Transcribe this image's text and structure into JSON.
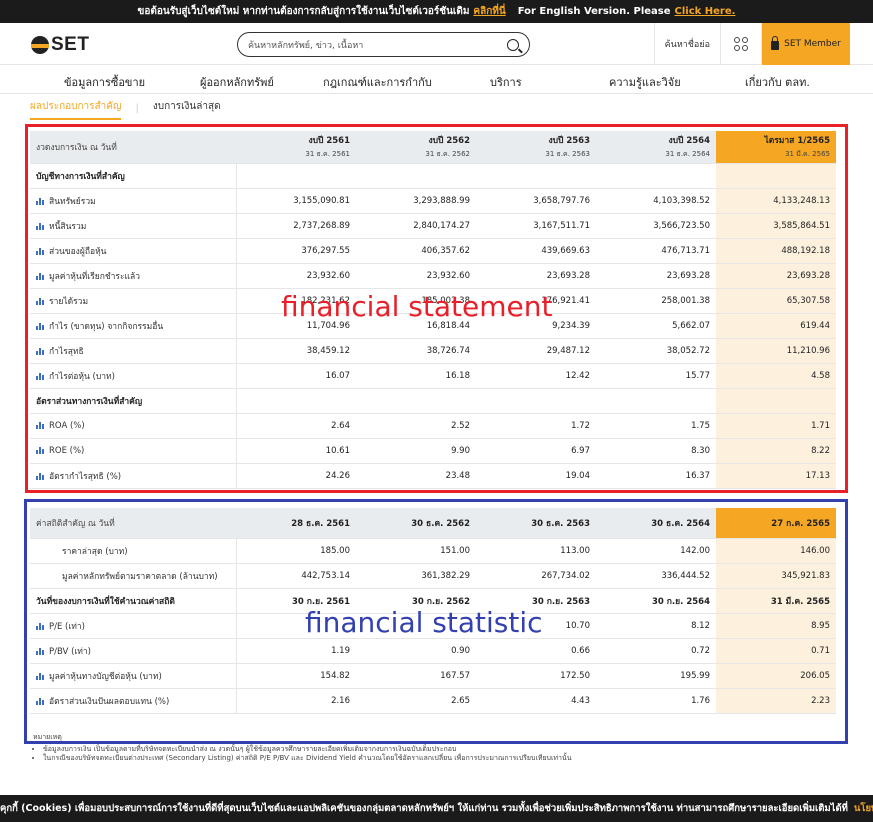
{
  "topbar": {
    "message": "ขอต้อนรับสู่เว็บไซต์ใหม่ หากท่านต้องการกลับสู่การใช้งานเว็บไซต์เวอร์ชันเดิม",
    "click_here_th": "คลิกที่นี่",
    "english_prompt": "For English Version. Please",
    "click_here_en": "Click Here."
  },
  "header": {
    "logo_text": "SET",
    "search_placeholder": "ค้นหาหลักทรัพย์, ข่าว, เนื้อหา",
    "quick_search": "ค้นหาชื่อย่อ",
    "member_label": "SET Member"
  },
  "nav": [
    "ข้อมูลการซื้อขาย",
    "ผู้ออกหลักทรัพย์",
    "กฎเกณฑ์และการกำกับ",
    "บริการ",
    "ความรู้และวิจัย",
    "เกี่ยวกับ ตลท."
  ],
  "subnav": {
    "active": "ผลประกอบการสำคัญ",
    "other": "งบการเงินล่าสุด"
  },
  "statement": {
    "header_label": "งวดงบการเงิน ณ วันที่",
    "columns": [
      {
        "title": "งบปี 2561",
        "date": "31 ธ.ค. 2561"
      },
      {
        "title": "งบปี 2562",
        "date": "31 ธ.ค. 2562"
      },
      {
        "title": "งบปี 2563",
        "date": "31 ธ.ค. 2563"
      },
      {
        "title": "งบปี 2564",
        "date": "31 ธ.ค. 2564"
      },
      {
        "title": "ไตรมาส 1/2565",
        "date": "31 มี.ค. 2565"
      }
    ],
    "section1": "บัญชีทางการเงินที่สำคัญ",
    "rows1": [
      {
        "label": "สินทรัพย์รวม",
        "values": [
          "3,155,090.81",
          "3,293,888.99",
          "3,658,797.76",
          "4,103,398.52",
          "4,133,248.13"
        ]
      },
      {
        "label": "หนี้สินรวม",
        "values": [
          "2,737,268.89",
          "2,840,174.27",
          "3,167,511.71",
          "3,566,723.50",
          "3,585,864.51"
        ]
      },
      {
        "label": "ส่วนของผู้ถือหุ้น",
        "values": [
          "376,297.55",
          "406,357.62",
          "439,669.63",
          "476,713.71",
          "488,192.18"
        ]
      },
      {
        "label": "มูลค่าหุ้นที่เรียกชำระแล้ว",
        "values": [
          "23,932.60",
          "23,932.60",
          "23,693.28",
          "23,693.28",
          "23,693.28"
        ]
      },
      {
        "label": "รายได้รวม",
        "values": [
          "182,231.62",
          "185,002.38",
          "176,921.41",
          "258,001.38",
          "65,307.58"
        ]
      },
      {
        "label": "กำไร (ขาดทุน) จากกิจกรรมอื่น",
        "values": [
          "11,704.96",
          "16,818.44",
          "9,234.39",
          "5,662.07",
          "619.44"
        ]
      },
      {
        "label": "กำไรสุทธิ",
        "values": [
          "38,459.12",
          "38,726.74",
          "29,487.12",
          "38,052.72",
          "11,210.96"
        ]
      },
      {
        "label": "กำไรต่อหุ้น (บาท)",
        "values": [
          "16.07",
          "16.18",
          "12.42",
          "15.77",
          "4.58"
        ]
      }
    ],
    "section2": "อัตราส่วนทางการเงินที่สำคัญ",
    "rows2": [
      {
        "label": "ROA (%)",
        "values": [
          "2.64",
          "2.52",
          "1.72",
          "1.75",
          "1.71"
        ]
      },
      {
        "label": "ROE (%)",
        "values": [
          "10.61",
          "9.90",
          "6.97",
          "8.30",
          "8.22"
        ]
      },
      {
        "label": "อัตรากำไรสุทธิ (%)",
        "values": [
          "24.26",
          "23.48",
          "19.04",
          "16.37",
          "17.13"
        ]
      }
    ]
  },
  "statistic": {
    "header_label": "ค่าสถิติสำคัญ ณ วันที่",
    "columns": [
      "28 ธ.ค. 2561",
      "30 ธ.ค. 2562",
      "30 ธ.ค. 2563",
      "30 ธ.ค. 2564",
      "27 ก.ค. 2565"
    ],
    "rows_top": [
      {
        "label": "ราคาล่าสุด (บาท)",
        "values": [
          "185.00",
          "151.00",
          "113.00",
          "142.00",
          "146.00"
        ]
      },
      {
        "label": "มูลค่าหลักทรัพย์ตามราคาตลาด (ล้านบาท)",
        "values": [
          "442,753.14",
          "361,382.29",
          "267,734.02",
          "336,444.52",
          "345,921.83"
        ]
      }
    ],
    "date_row": {
      "label": "วันที่ของงบการเงินที่ใช้คำนวณค่าสถิติ",
      "values": [
        "30 ก.ย. 2561",
        "30 ก.ย. 2562",
        "30 ก.ย. 2563",
        "30 ก.ย. 2564",
        "31 มี.ค. 2565"
      ]
    },
    "rows": [
      {
        "label": "P/E (เท่า)",
        "values": [
          "",
          "",
          "10.70",
          "8.12",
          "8.95"
        ]
      },
      {
        "label": "P/BV (เท่า)",
        "values": [
          "1.19",
          "0.90",
          "0.66",
          "0.72",
          "0.71"
        ]
      },
      {
        "label": "มูลค่าหุ้นทางบัญชีต่อหุ้น (บาท)",
        "values": [
          "154.82",
          "167.57",
          "172.50",
          "195.99",
          "206.05"
        ]
      },
      {
        "label": "อัตราส่วนเงินปันผลตอบแทน (%)",
        "values": [
          "2.16",
          "2.65",
          "4.43",
          "1.76",
          "2.23"
        ]
      }
    ]
  },
  "annotations": {
    "red": "financial statement",
    "blue": "financial statistic"
  },
  "notes": {
    "title": "หมายเหตุ",
    "items": [
      "ข้อมูลงบการเงิน เป็นข้อมูลตามที่บริษัทจดทะเบียนนำส่ง ณ งวดนั้นๆ ผู้ใช้ข้อมูลควรศึกษารายละเอียดเพิ่มเติมจากงบการเงินฉบับเต็มประกอบ",
      "ในกรณีของบริษัทจดทะเบียนต่างประเทศ (Secondary Listing) ค่าสถิติ P/E P/BV และ Dividend Yield คำนวณโดยใช้อัตราแลกเปลี่ยน เพื่อการประมาณการเปรียบเทียบเท่านั้น"
    ]
  },
  "cookie": {
    "text": "คุกกี้ (Cookies) เพื่อมอบประสบการณ์การใช้งานที่ดีที่สุดบนเว็บไซต์และแอปพลิเคชันของกลุ่มตลาดหลักทรัพย์ฯ ให้แก่ท่าน รวมทั้งเพื่อช่วยเพิ่มประสิทธิภาพการใช้งาน ท่านสามารถศึกษารายละเอียดเพิ่มเติมได้ที่",
    "policy": "นโยบายการ"
  }
}
